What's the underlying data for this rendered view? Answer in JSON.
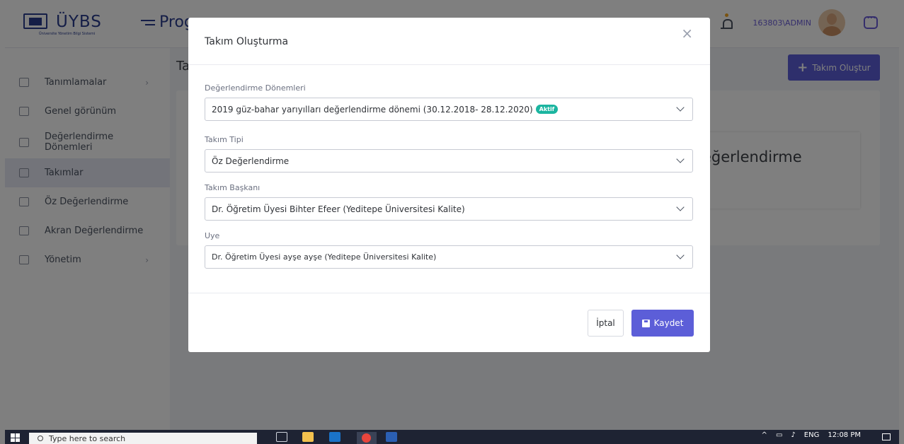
{
  "header": {
    "logo_text": "ÜYBS",
    "logo_subtitle": "Üniversite Yönetim Bilgi Sistemi",
    "page_heading": "Prog",
    "user": "163803\\ADMIN"
  },
  "sidebar": {
    "items": [
      {
        "label": "Tanımlamalar",
        "has_submenu": true
      },
      {
        "label": "Genel görünüm",
        "has_submenu": false
      },
      {
        "label": "Değerlendirme Dönemleri",
        "has_submenu": false
      },
      {
        "label": "Takımlar",
        "has_submenu": false,
        "active": true
      },
      {
        "label": "Öz Değerlendirme",
        "has_submenu": false
      },
      {
        "label": "Akran Değerlendirme",
        "has_submenu": false
      },
      {
        "label": "Yönetim",
        "has_submenu": true
      }
    ]
  },
  "content": {
    "title_partial": "Ta",
    "create_button": "Takım Oluştur",
    "card_title_partial": "eğerlendirme"
  },
  "modal": {
    "title": "Takım Oluşturma",
    "close_glyph": "×",
    "fields": {
      "period": {
        "label": "Değerlendirme Dönemleri",
        "value": "2019 güz-bahar yarıyılları değerlendirme dönemi (30.12.2018- 28.12.2020)",
        "badge": "Aktif"
      },
      "team_type": {
        "label": "Takım Tipi",
        "value": "Öz Değerlendirme"
      },
      "team_leader": {
        "label": "Takım Başkanı",
        "value": "Dr. Öğretim Üyesi Bihter Efeer (Yeditepe Üniversitesi Kalite)"
      },
      "member": {
        "label": "Uye",
        "value": "Dr. Öğretim Üyesi ayşe ayşe (Yeditepe Üniversitesi Kalite)"
      }
    },
    "cancel_label": "İptal",
    "save_label": "Kaydet"
  },
  "taskbar": {
    "search_placeholder": "Type here to search",
    "language": "ENG",
    "time": "12:08 PM"
  },
  "colors": {
    "primary": "#5c5ed8",
    "brand": "#2b3d8f",
    "badge": "#1bb5a0"
  }
}
